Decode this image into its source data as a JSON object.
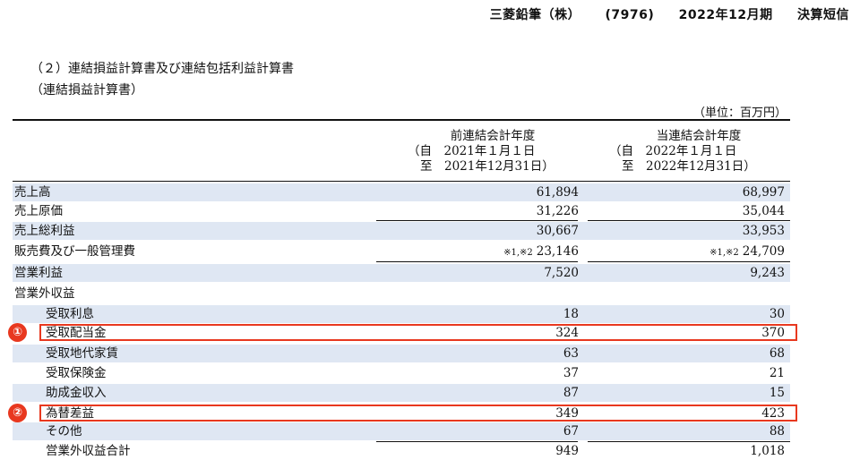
{
  "header": {
    "company": "三菱鉛筆（株）",
    "code": "(7976)",
    "period": "2022年12月期",
    "doc": "決算短信"
  },
  "section": {
    "title": "（２）連結損益計算書及び連結包括利益計算書",
    "subtitle": "（連結損益計算書）",
    "unit": "（単位：百万円）"
  },
  "columns": {
    "prev": {
      "title": "前連結会計年度",
      "from": "（自　2021年１月１日",
      "to": "至　2021年12月31日）"
    },
    "cur": {
      "title": "当連結会計年度",
      "from": "（自　2022年１月１日",
      "to": "至　2022年12月31日）"
    }
  },
  "rows": [
    {
      "label": "売上高",
      "prev": "61,894",
      "cur": "68,997"
    },
    {
      "label": "売上原価",
      "prev": "31,226",
      "cur": "35,044"
    },
    {
      "label": "売上総利益",
      "prev": "30,667",
      "cur": "33,953"
    },
    {
      "label": "販売費及び一般管理費",
      "prev_note": "※1,※2",
      "prev": "23,146",
      "cur_note": "※1,※2",
      "cur": "24,709"
    },
    {
      "label": "営業利益",
      "prev": "7,520",
      "cur": "9,243"
    },
    {
      "label": "営業外収益",
      "prev": "",
      "cur": ""
    },
    {
      "label": "受取利息",
      "prev": "18",
      "cur": "30"
    },
    {
      "label": "受取配当金",
      "prev": "324",
      "cur": "370"
    },
    {
      "label": "受取地代家賃",
      "prev": "63",
      "cur": "68"
    },
    {
      "label": "受取保険金",
      "prev": "37",
      "cur": "21"
    },
    {
      "label": "助成金収入",
      "prev": "87",
      "cur": "15"
    },
    {
      "label": "為替差益",
      "prev": "349",
      "cur": "423"
    },
    {
      "label": "その他",
      "prev": "67",
      "cur": "88"
    },
    {
      "label": "営業外収益合計",
      "prev": "949",
      "cur": "1,018"
    }
  ],
  "annotations": {
    "mark1": "①",
    "mark2": "②"
  },
  "colors": {
    "highlight": "#e8381f",
    "row_shade": "#dfe7f3"
  }
}
